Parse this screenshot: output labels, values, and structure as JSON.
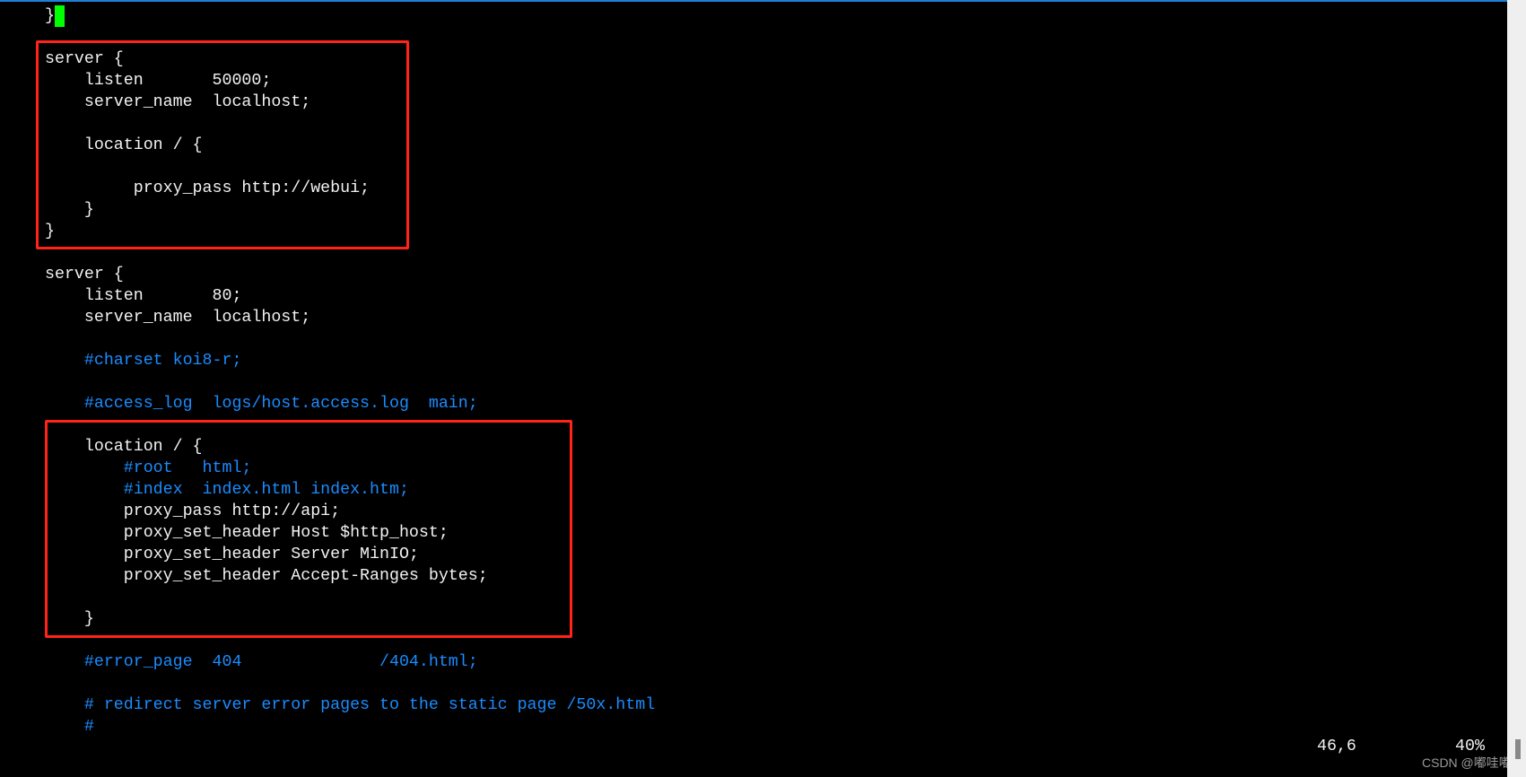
{
  "editor": {
    "lines": [
      {
        "row": 0,
        "text": "}",
        "type": "code",
        "cursor": true
      },
      {
        "row": 2,
        "text": "server {",
        "type": "code"
      },
      {
        "row": 3,
        "text": "    listen       50000;",
        "type": "code"
      },
      {
        "row": 4,
        "text": "    server_name  localhost;",
        "type": "code"
      },
      {
        "row": 6,
        "text": "    location / {",
        "type": "code"
      },
      {
        "row": 8,
        "text": "         proxy_pass http://webui;",
        "type": "code"
      },
      {
        "row": 9,
        "text": "    }",
        "type": "code"
      },
      {
        "row": 10,
        "text": "}",
        "type": "code"
      },
      {
        "row": 12,
        "text": "server {",
        "type": "code"
      },
      {
        "row": 13,
        "text": "    listen       80;",
        "type": "code"
      },
      {
        "row": 14,
        "text": "    server_name  localhost;",
        "type": "code"
      },
      {
        "row": 16,
        "text": "    #charset koi8-r;",
        "type": "comment"
      },
      {
        "row": 18,
        "text": "    #access_log  logs/host.access.log  main;",
        "type": "comment"
      },
      {
        "row": 20,
        "text": "    location / {",
        "type": "code"
      },
      {
        "row": 21,
        "text": "        #root   html;",
        "type": "comment"
      },
      {
        "row": 22,
        "text": "        #index  index.html index.htm;",
        "type": "comment"
      },
      {
        "row": 23,
        "text": "        proxy_pass http://api;",
        "type": "code"
      },
      {
        "row": 24,
        "text": "        proxy_set_header Host $http_host;",
        "type": "code"
      },
      {
        "row": 25,
        "text": "        proxy_set_header Server MinIO;",
        "type": "code"
      },
      {
        "row": 26,
        "text": "        proxy_set_header Accept-Ranges bytes;",
        "type": "code"
      },
      {
        "row": 28,
        "text": "    }",
        "type": "code"
      },
      {
        "row": 30,
        "text": "    #error_page  404              /404.html;",
        "type": "comment"
      },
      {
        "row": 32,
        "text": "    # redirect server error pages to the static page /50x.html",
        "type": "comment"
      },
      {
        "row": 33,
        "text": "    #",
        "type": "comment"
      }
    ]
  },
  "status": {
    "position": "46,6",
    "percent": "40%"
  },
  "watermark": "CSDN @嘟哇嘟",
  "colors": {
    "text": "#f2f2f2",
    "comment": "#1a8cff",
    "cursor": "#00ff00",
    "highlight_box": "#ff2318",
    "background": "#000000"
  }
}
